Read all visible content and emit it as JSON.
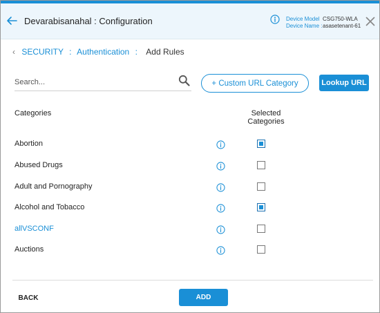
{
  "header": {
    "title": "Devarabisanahal : Configuration",
    "device_model_label": "Device Model",
    "device_model_value": "CSG750-WLA",
    "device_name_label": "Device Name :",
    "device_name_value": "asasetenant-61"
  },
  "breadcrumb": {
    "items": [
      "SECURITY",
      "Authentication"
    ],
    "separator": ":",
    "current": "Add Rules"
  },
  "search": {
    "placeholder": "Search...",
    "value": ""
  },
  "buttons": {
    "custom_url": "+ Custom URL Category",
    "lookup_url": "Lookup URL",
    "back": "BACK",
    "add": "ADD"
  },
  "table": {
    "col_categories": "Categories",
    "col_selected": "Selected Categories",
    "rows": [
      {
        "label": "Abortion",
        "checked": true,
        "link": false
      },
      {
        "label": "Abused Drugs",
        "checked": false,
        "link": false
      },
      {
        "label": "Adult and Pornography",
        "checked": false,
        "link": false
      },
      {
        "label": "Alcohol and Tobacco",
        "checked": true,
        "link": false
      },
      {
        "label": "allVSCONF",
        "checked": false,
        "link": true
      },
      {
        "label": "Auctions",
        "checked": false,
        "link": false
      }
    ]
  },
  "icons": {
    "back": "arrow-left-icon",
    "info": "info-icon",
    "close": "close-icon",
    "search": "search-icon",
    "chevron": "chevron-left-icon"
  },
  "colors": {
    "accent": "#1a8fd6",
    "header_bg": "#edf6fc"
  }
}
